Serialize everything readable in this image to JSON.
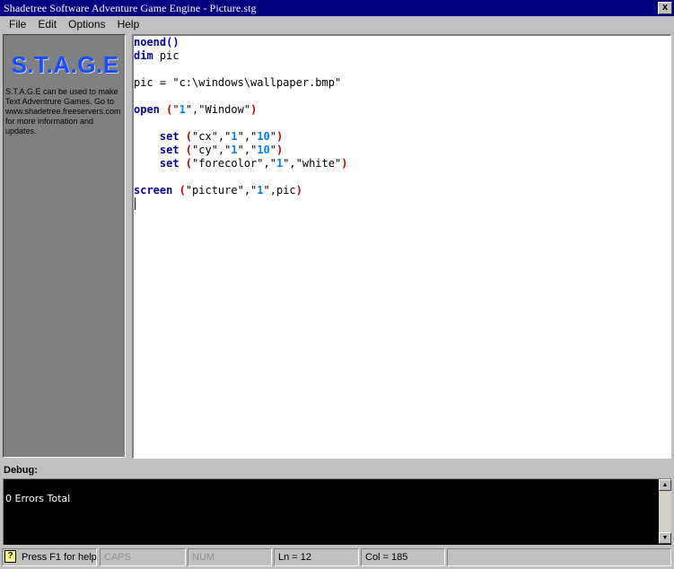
{
  "window": {
    "title": "Shadetree Software Adventure Game Engine - Picture.stg",
    "close_glyph": "x"
  },
  "menu": {
    "items": [
      "File",
      "Edit",
      "Options",
      "Help"
    ]
  },
  "side": {
    "logo": "S.T.A.G.E",
    "description": "S.T.A.G.E can be used to make Text Adventrure Games. Go to www.shadetree.freeservers.com for more information and updates."
  },
  "editor": {
    "lines": [
      [
        {
          "t": "noend()",
          "c": "kw"
        }
      ],
      [
        {
          "t": "dim",
          "c": "kw"
        },
        {
          "t": " pic",
          "c": "tx"
        }
      ],
      [],
      [
        {
          "t": "pic = \"c:\\windows\\wallpaper.bmp\"",
          "c": "tx"
        }
      ],
      [],
      [
        {
          "t": "open",
          "c": "kw"
        },
        {
          "t": " (",
          "c": "pn"
        },
        {
          "t": "\"",
          "c": "tx"
        },
        {
          "t": "1",
          "c": "nm"
        },
        {
          "t": "\",\"Window\"",
          "c": "tx"
        },
        {
          "t": ")",
          "c": "pn"
        }
      ],
      [],
      [
        {
          "t": "    set",
          "c": "kw"
        },
        {
          "t": " (",
          "c": "pn"
        },
        {
          "t": "\"cx\",\"",
          "c": "tx"
        },
        {
          "t": "1",
          "c": "nm"
        },
        {
          "t": "\",\"",
          "c": "tx"
        },
        {
          "t": "10",
          "c": "nm"
        },
        {
          "t": "\"",
          "c": "tx"
        },
        {
          "t": ")",
          "c": "pn"
        }
      ],
      [
        {
          "t": "    set",
          "c": "kw"
        },
        {
          "t": " (",
          "c": "pn"
        },
        {
          "t": "\"cy\",\"",
          "c": "tx"
        },
        {
          "t": "1",
          "c": "nm"
        },
        {
          "t": "\",\"",
          "c": "tx"
        },
        {
          "t": "10",
          "c": "nm"
        },
        {
          "t": "\"",
          "c": "tx"
        },
        {
          "t": ")",
          "c": "pn"
        }
      ],
      [
        {
          "t": "    set",
          "c": "kw"
        },
        {
          "t": " (",
          "c": "pn"
        },
        {
          "t": "\"forecolor\",\"",
          "c": "tx"
        },
        {
          "t": "1",
          "c": "nm"
        },
        {
          "t": "\",\"white\"",
          "c": "tx"
        },
        {
          "t": ")",
          "c": "pn"
        }
      ],
      [],
      [
        {
          "t": "screen",
          "c": "kw"
        },
        {
          "t": " (",
          "c": "pn"
        },
        {
          "t": "\"picture\",\"",
          "c": "tx"
        },
        {
          "t": "1",
          "c": "nm"
        },
        {
          "t": "\",pic",
          "c": "tx"
        },
        {
          "t": ")",
          "c": "pn"
        }
      ],
      []
    ]
  },
  "debug": {
    "label": "Debug:",
    "output": "0 Errors Total"
  },
  "status": {
    "help_icon": "?",
    "help": "Press F1 for help",
    "caps": "CAPS",
    "num": "NUM",
    "line": "Ln = 12",
    "col": "Col = 185"
  },
  "colors": {
    "titlebar": "#000080",
    "keyword": "#0000a0",
    "paren": "#c00000",
    "number": "#0080ff",
    "logo": "#1a4dff"
  }
}
